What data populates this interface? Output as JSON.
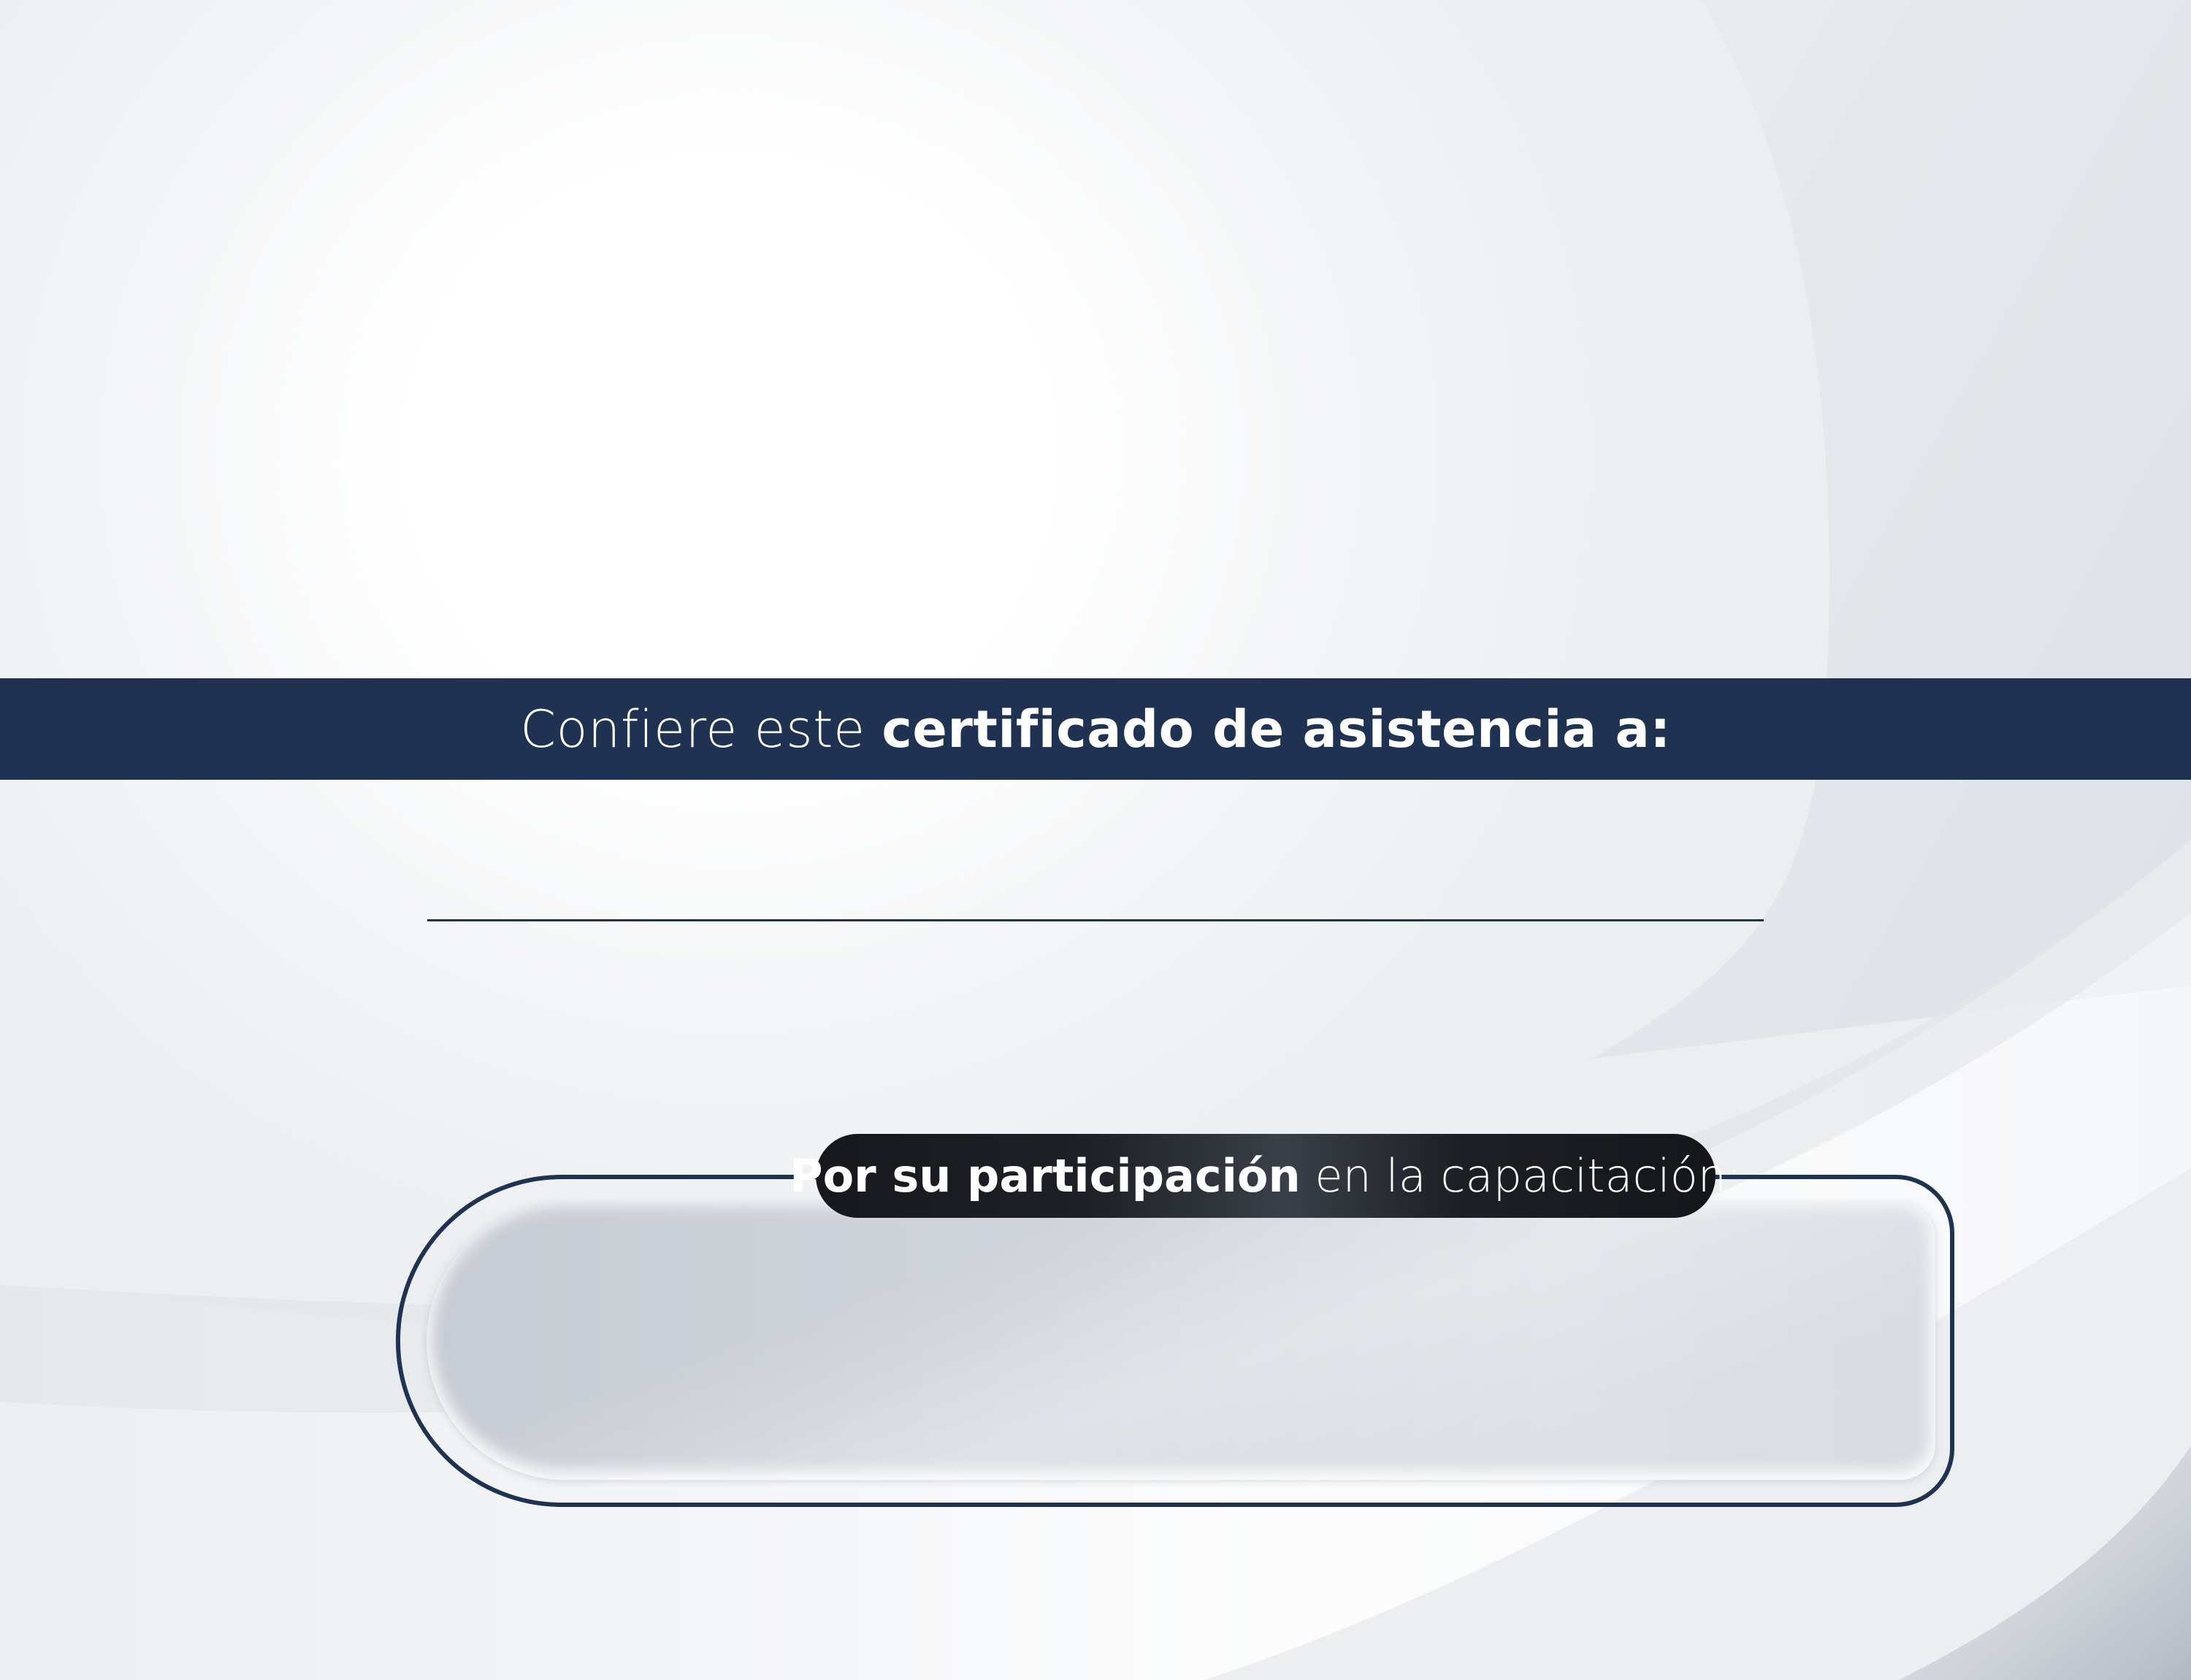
{
  "certificate": {
    "conferral_light": "Confiere este ",
    "conferral_bold": "certificado de asistencia a:",
    "participation_bold": "Por su participación",
    "participation_light": " en la capacitación:"
  },
  "colors": {
    "navy": "#1f3251",
    "pill_dark": "#16181d",
    "panel_gray": "#cfd3da",
    "background": "#f2f3f5"
  }
}
